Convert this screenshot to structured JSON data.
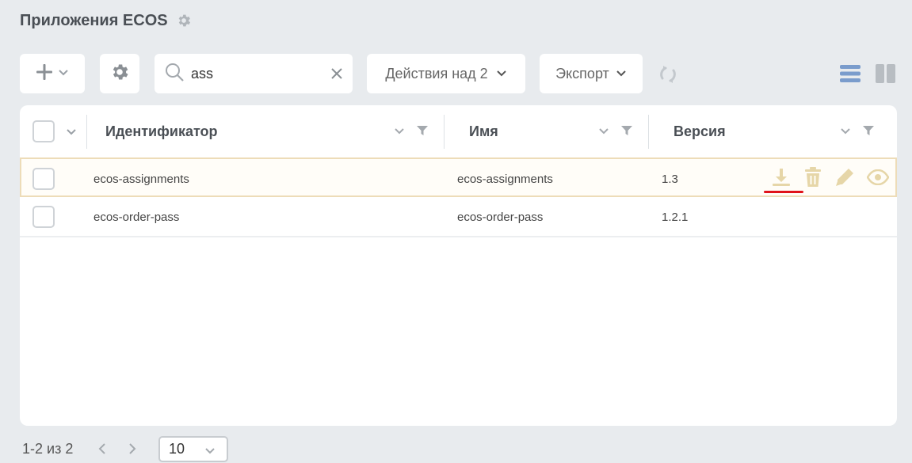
{
  "page": {
    "title": "Приложения ECOS"
  },
  "toolbar": {
    "search": {
      "value": "ass",
      "placeholder": ""
    },
    "actions_label": "Действия над 2",
    "export_label": "Экспорт"
  },
  "grid": {
    "columns": [
      {
        "label": "Идентификатор"
      },
      {
        "label": "Имя"
      },
      {
        "label": "Версия"
      }
    ],
    "rows": [
      {
        "id": "ecos-assignments",
        "name": "ecos-assignments",
        "version": "1.3",
        "active": true,
        "actions": [
          "download-icon",
          "trash-icon",
          "pencil-icon",
          "eye-icon"
        ]
      },
      {
        "id": "ecos-order-pass",
        "name": "ecos-order-pass",
        "version": "1.2.1",
        "active": false
      }
    ]
  },
  "pagination": {
    "range_text": "1-2 из 2",
    "page_size": "10"
  },
  "colors": {
    "background": "#e8ebee",
    "accent_blue": "#7a9ccc",
    "action_icon": "#e6d6a8",
    "underline_red": "#e0121b"
  }
}
